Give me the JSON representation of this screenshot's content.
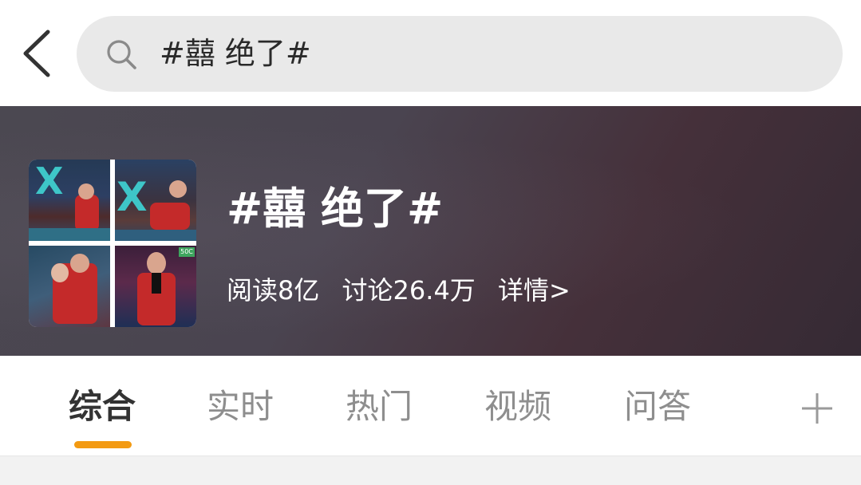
{
  "header": {
    "back_icon": "chevron-left-icon",
    "search": {
      "icon": "search-icon",
      "query": "#囍 绝了#"
    }
  },
  "topic": {
    "title": "#囍 绝了#",
    "stats": {
      "reads": "阅读8亿",
      "discussions": "讨论26.4万",
      "detail_link": "详情>"
    }
  },
  "tabs": {
    "items": [
      {
        "label": "综合",
        "active": true
      },
      {
        "label": "实时",
        "active": false
      },
      {
        "label": "热门",
        "active": false
      },
      {
        "label": "视频",
        "active": false
      },
      {
        "label": "问答",
        "active": false
      }
    ],
    "add_icon": "plus-icon"
  },
  "colors": {
    "accent": "#f39a12",
    "search_bg": "#e9e9e9",
    "banner_bg": "#4a4450",
    "tab_inactive": "#8e8e8e",
    "tab_active": "#333333"
  }
}
